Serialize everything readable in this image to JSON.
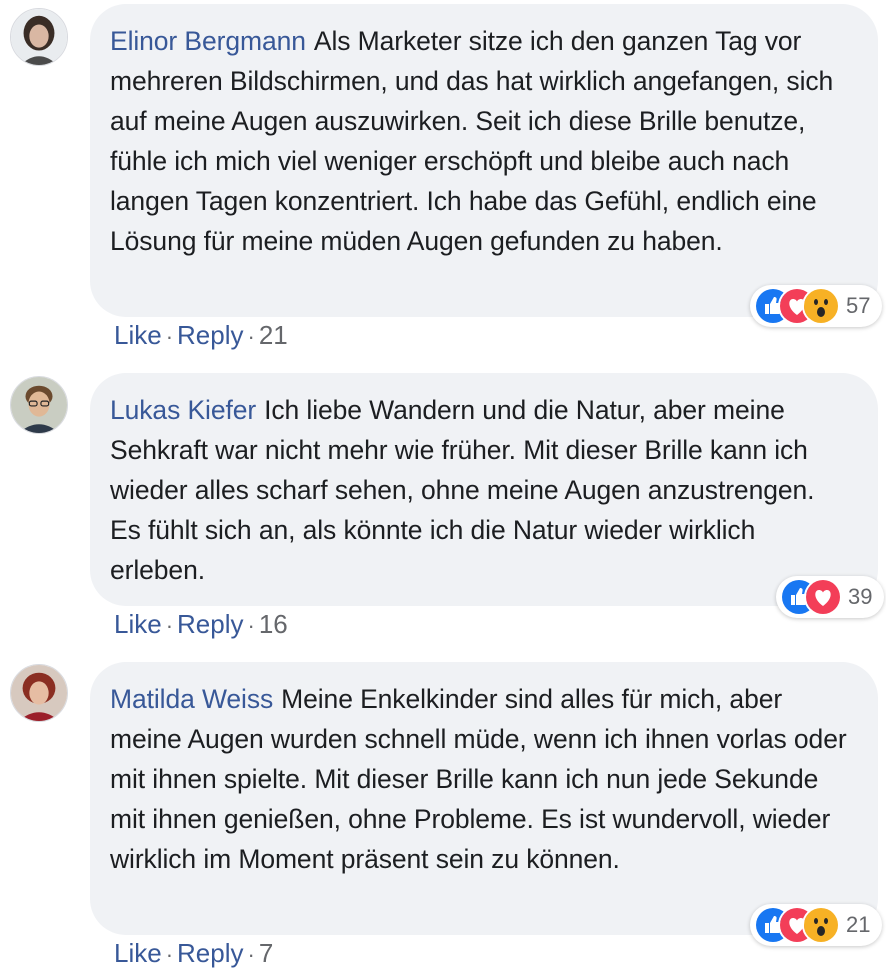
{
  "comments": [
    {
      "author": "Elinor Bergmann",
      "text": "Als Marketer sitze ich den ganzen Tag vor mehreren Bildschirmen, und das hat wirklich angefangen, sich auf meine Augen auszuwirken. Seit ich diese Brille benutze, fühle ich mich viel weniger erschöpft und bleibe auch nach langen Tagen konzentriert. Ich habe das Gefühl, endlich eine Lösung für meine müden Augen gefunden zu haben.",
      "reaction_icons": [
        "like-icon",
        "love-icon",
        "wow-icon"
      ],
      "reaction_count": "57",
      "like_label": "Like",
      "reply_label": "Reply",
      "separator": "·",
      "age": "21"
    },
    {
      "author": "Lukas Kiefer",
      "text": "Ich liebe Wandern und die Natur, aber meine Sehkraft war nicht mehr wie früher. Mit dieser Brille kann ich wieder alles scharf sehen, ohne meine Augen anzustrengen. Es fühlt sich an, als könnte ich die Natur wieder wirklich erleben.",
      "reaction_icons": [
        "like-icon",
        "love-icon"
      ],
      "reaction_count": "39",
      "like_label": "Like",
      "reply_label": "Reply",
      "separator": "·",
      "age": "16"
    },
    {
      "author": "Matilda Weiss",
      "text": "Meine Enkelkinder sind alles für mich, aber meine Augen wurden schnell müde, wenn ich ihnen vorlas oder mit ihnen spielte. Mit dieser Brille kann ich nun jede Sekunde mit ihnen genießen, ohne Probleme. Es ist wundervoll, wieder wirklich im Moment präsent sein zu können.",
      "reaction_icons": [
        "like-icon",
        "love-icon",
        "wow-icon"
      ],
      "reaction_count": "21",
      "like_label": "Like",
      "reply_label": "Reply",
      "separator": "·",
      "age": "7"
    }
  ],
  "colors": {
    "author_link": "#385898",
    "bubble_bg": "#f0f2f5",
    "like_blue": "#1877f2",
    "love_red": "#f33e58",
    "wow_yellow": "#f7b125",
    "meta_gray": "#65676b"
  }
}
